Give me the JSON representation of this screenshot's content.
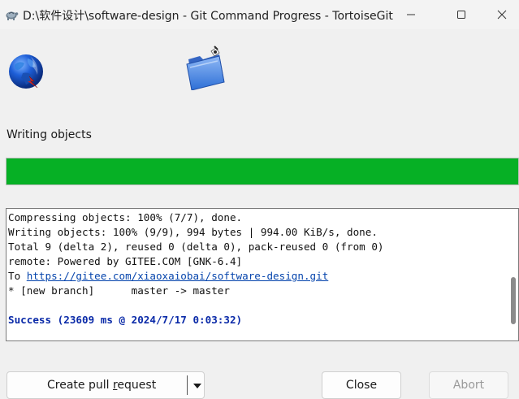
{
  "window": {
    "title": "D:\\软件设计\\software-design - Git Command Progress - TortoiseGit"
  },
  "status": {
    "label": "Writing objects",
    "progress_percent": 100,
    "progress_color": "#06b025"
  },
  "log": {
    "lines": [
      "Compressing objects: 100% (7/7), done.",
      "Writing objects: 100% (9/9), 994 bytes | 994.00 KiB/s, done.",
      "Total 9 (delta 2), reused 0 (delta 0), pack-reused 0 (from 0)",
      "remote: Powered by GITEE.COM [GNK-6.4]"
    ],
    "to_prefix": "To ",
    "remote_url": "https://gitee.com/xiaoxaiobai/software-design.git",
    "branch_line": "* [new branch]      master -> master",
    "success": "Success (23609 ms @ 2024/7/17 0:03:32)",
    "success_color": "#0a2aa8"
  },
  "buttons": {
    "pull_request_prefix": "Create pull ",
    "pull_request_accel": "r",
    "pull_request_suffix": "equest",
    "close": "Close",
    "abort": "Abort"
  },
  "icons": {
    "app": "tortoisegit-icon",
    "globe": "globe-icon",
    "folder": "folder-icon"
  }
}
